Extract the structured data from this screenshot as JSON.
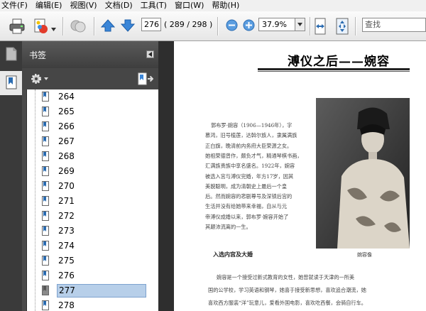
{
  "menu": [
    "文件(F)",
    "编辑(E)",
    "视图(V)",
    "文档(D)",
    "工具(T)",
    "窗口(W)",
    "帮助(H)"
  ],
  "toolbar": {
    "current_page": "276",
    "page_count": "( 289 / 298 )",
    "zoom": "37.9%",
    "search_placeholder": "查找"
  },
  "panel": {
    "title": "书签",
    "bookmarks": [
      "264",
      "265",
      "266",
      "267",
      "268",
      "269",
      "270",
      "271",
      "272",
      "273",
      "274",
      "275",
      "276",
      "277",
      "278"
    ],
    "selected_index": 13
  },
  "document": {
    "title": "溥仪之后——婉容",
    "photo_caption": "婉容像",
    "intro_lines": [
      "郭布罗·婉容（1906—1946年），字",
      "慕鸿，旧号植莲，达斡尔族人，隶属满族",
      "正白旗，晚清前内务府大臣荣源之女。",
      "她祖荣德曾作，颇负才气，精通琴棋书画，",
      "汇满族贵族中享名盛名。1922年，婉容",
      "被选入宫与溥仪完婚，年方17岁，因其",
      "美貌聪明，成为清朝史上最后一个皇",
      "后。然而婉容的悲剧尊号及深锁后宫的",
      "生活并没有给她带来幸福，自从与元",
      "帝溥仪成婚以来，郭布罗·婉容开始了",
      "其颠沛流离的一生。"
    ],
    "section_title": "入选内宫及大婚",
    "body_lines": [
      "婉容是一个接受过新式教育的女性，她曾就读于天津的一所美",
      "国的公学校，学习英语和钢琴，她喜于接受新思想，喜欢追合潮流，她",
      "喜欢西方服装“洋”玩意儿，爱看外国电影，喜欢吃西餐，会骑自行车。"
    ]
  }
}
